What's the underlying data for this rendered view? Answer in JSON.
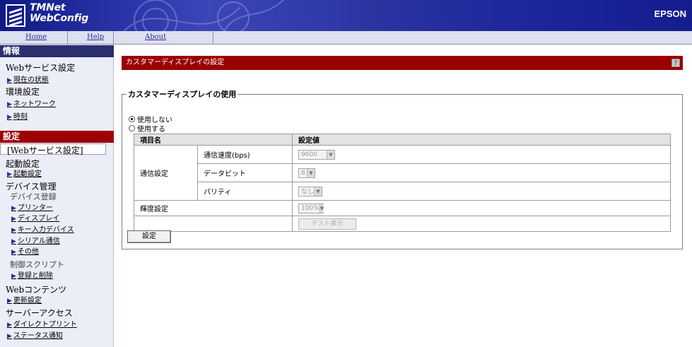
{
  "header": {
    "app_name_line1": "TMNet",
    "app_name_line2": "WebConfig",
    "brand": "EPSON"
  },
  "nav": {
    "home": "Home",
    "help": "Help",
    "about": "About"
  },
  "sidebar": {
    "info_title": "情報",
    "web_service_settings": "Webサービス設定",
    "current_status": "現在の状態",
    "environment_settings": "環境設定",
    "network": "ネットワーク",
    "time": "時刻",
    "settings_title": "設定",
    "web_service_settings_bracket": "[Webサービス設定]",
    "startup_settings": "起動設定",
    "startup_settings_link": "起動設定",
    "device_management": "デバイス管理",
    "device_registration": "デバイス登録",
    "printer": "プリンター",
    "display": "ディスプレイ",
    "key_input_device": "キー入力デバイス",
    "serial_comm": "シリアル通信",
    "other": "その他",
    "control_script": "制御スクリプト",
    "register_delete": "登録と削除",
    "web_contents": "Webコンテンツ",
    "update_settings": "更新設定",
    "server_access": "サーバーアクセス",
    "direct_print": "ダイレクトプリント",
    "status_notify": "ステータス通知"
  },
  "main": {
    "title": "カスタマーディスプレイの設定",
    "help_icon_label": "?",
    "group_label": "カスタマーディスプレイの使用",
    "radio_not_use": "使用しない",
    "radio_use": "使用する",
    "table": {
      "col_item": "項目名",
      "col_value": "設定値",
      "comm_settings": "通信設定",
      "baud_rate": "通信速度(bps)",
      "baud_rate_value": "9600",
      "data_bits": "データビット",
      "data_bits_value": "8",
      "parity": "パリティ",
      "parity_value": "なし",
      "brightness": "輝度設定",
      "brightness_value": "100%",
      "test_button": "テスト表示"
    },
    "set_button": "設定"
  },
  "colors": {
    "header_blue": "#1b249a",
    "title_red": "#990000",
    "settings_red": "#9f0000",
    "info_navy": "#2a2f6e"
  }
}
